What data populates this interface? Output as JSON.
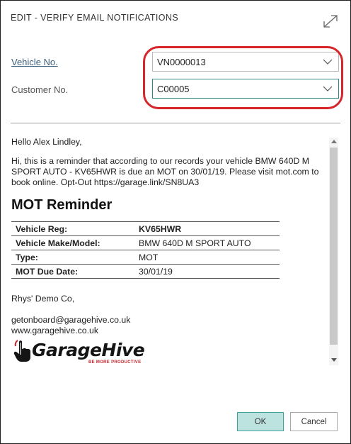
{
  "dialog": {
    "title": "EDIT - VERIFY EMAIL NOTIFICATIONS"
  },
  "fields": {
    "vehicle_label": "Vehicle No.",
    "vehicle_value": "VN0000013",
    "customer_label": "Customer No.",
    "customer_value": "C00005"
  },
  "email": {
    "greeting": "Hello Alex Lindley,",
    "message": "Hi, this is a reminder that according to our records your vehicle BMW 640D M SPORT AUTO - KV65HWR is due an MOT on 30/01/19. Please visit mot.com to book online. Opt-Out https://garage.link/SN8UA3",
    "heading": "MOT Reminder",
    "table": [
      {
        "key": "Vehicle Reg:",
        "value": "KV65HWR"
      },
      {
        "key": "Vehicle Make/Model:",
        "value": "BMW 640D M SPORT AUTO"
      },
      {
        "key": "Type:",
        "value": "MOT"
      },
      {
        "key": "MOT Due Date:",
        "value": "30/01/19"
      }
    ],
    "signoff": "Rhys' Demo Co,",
    "email_address": "getonboard@garagehive.co.uk",
    "website": "www.garagehive.co.uk",
    "logo_text": "GarageHive",
    "logo_tagline": "BE MORE PRODUCTIVE"
  },
  "buttons": {
    "ok": "OK",
    "cancel": "Cancel"
  },
  "colors": {
    "highlight": "#d7262b",
    "ok_bg": "#bde3e1",
    "focus": "#2d8a85",
    "logo_red": "#c8262c"
  },
  "icons": [
    "expand-icon",
    "chevron-down-icon",
    "hand-pointer-icon",
    "scroll-up-icon",
    "scroll-down-icon"
  ]
}
